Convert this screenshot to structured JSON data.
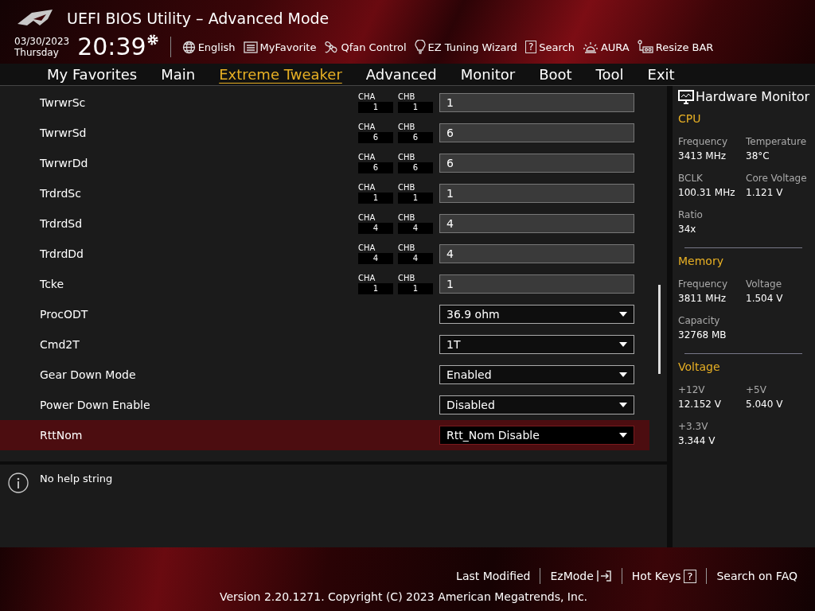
{
  "window": {
    "title": "UEFI BIOS Utility – Advanced Mode"
  },
  "clock": {
    "date": "03/30/2023",
    "day": "Thursday",
    "time": "20:39"
  },
  "toolbar": [
    {
      "label": "English"
    },
    {
      "label": "MyFavorite"
    },
    {
      "label": "Qfan Control"
    },
    {
      "label": "EZ Tuning Wizard"
    },
    {
      "label": "Search",
      "badge": "?"
    },
    {
      "label": "AURA"
    },
    {
      "label": "Resize BAR"
    }
  ],
  "tabs": [
    {
      "label": "My Favorites",
      "selected": false
    },
    {
      "label": "Main",
      "selected": false
    },
    {
      "label": "Extreme Tweaker",
      "selected": true
    },
    {
      "label": "Advanced",
      "selected": false
    },
    {
      "label": "Monitor",
      "selected": false
    },
    {
      "label": "Boot",
      "selected": false
    },
    {
      "label": "Tool",
      "selected": false
    },
    {
      "label": "Exit",
      "selected": false
    }
  ],
  "settings": [
    {
      "kind": "channels",
      "label": "TwrwrSc",
      "cha_label": "CHA",
      "cha": "1",
      "chb_label": "CHB",
      "chb": "1",
      "value": "1",
      "selected": false
    },
    {
      "kind": "channels",
      "label": "TwrwrSd",
      "cha_label": "CHA",
      "cha": "6",
      "chb_label": "CHB",
      "chb": "6",
      "value": "6",
      "selected": false
    },
    {
      "kind": "channels",
      "label": "TwrwrDd",
      "cha_label": "CHA",
      "cha": "6",
      "chb_label": "CHB",
      "chb": "6",
      "value": "6",
      "selected": false
    },
    {
      "kind": "channels",
      "label": "TrdrdSc",
      "cha_label": "CHA",
      "cha": "1",
      "chb_label": "CHB",
      "chb": "1",
      "value": "1",
      "selected": false
    },
    {
      "kind": "channels",
      "label": "TrdrdSd",
      "cha_label": "CHA",
      "cha": "4",
      "chb_label": "CHB",
      "chb": "4",
      "value": "4",
      "selected": false
    },
    {
      "kind": "channels",
      "label": "TrdrdDd",
      "cha_label": "CHA",
      "cha": "4",
      "chb_label": "CHB",
      "chb": "4",
      "value": "4",
      "selected": false
    },
    {
      "kind": "channels",
      "label": "Tcke",
      "cha_label": "CHA",
      "cha": "1",
      "chb_label": "CHB",
      "chb": "1",
      "value": "1",
      "selected": false
    },
    {
      "kind": "dropdown",
      "label": "ProcODT",
      "value": "36.9 ohm",
      "selected": false
    },
    {
      "kind": "dropdown",
      "label": "Cmd2T",
      "value": "1T",
      "selected": false
    },
    {
      "kind": "dropdown",
      "label": "Gear Down Mode",
      "value": "Enabled",
      "selected": false
    },
    {
      "kind": "dropdown",
      "label": "Power Down Enable",
      "value": "Disabled",
      "selected": false
    },
    {
      "kind": "dropdown",
      "label": "RttNom",
      "value": "Rtt_Nom Disable",
      "selected": true
    }
  ],
  "help": "No help string",
  "hardware_monitor": {
    "title": "Hardware Monitor",
    "sections": [
      {
        "title": "CPU",
        "items": [
          {
            "label": "Frequency",
            "value": "3413 MHz"
          },
          {
            "label": "Temperature",
            "value": "38°C"
          },
          {
            "label": "BCLK",
            "value": "100.31 MHz"
          },
          {
            "label": "Core Voltage",
            "value": "1.121 V"
          },
          {
            "label": "Ratio",
            "value": "34x"
          }
        ]
      },
      {
        "title": "Memory",
        "items": [
          {
            "label": "Frequency",
            "value": "3811 MHz"
          },
          {
            "label": "Voltage",
            "value": "1.504 V"
          },
          {
            "label": "Capacity",
            "value": "32768 MB"
          }
        ]
      },
      {
        "title": "Voltage",
        "items": [
          {
            "label": "+12V",
            "value": "12.152 V"
          },
          {
            "label": "+5V",
            "value": "5.040 V"
          },
          {
            "label": "+3.3V",
            "value": "3.344 V"
          }
        ]
      }
    ]
  },
  "footer": {
    "links": [
      {
        "label": "Last Modified"
      },
      {
        "label": "EzMode"
      },
      {
        "label": "Hot Keys",
        "badge": "?"
      },
      {
        "label": "Search on FAQ"
      }
    ],
    "copyright": "Version 2.20.1271. Copyright (C) 2023 American Megatrends, Inc."
  }
}
